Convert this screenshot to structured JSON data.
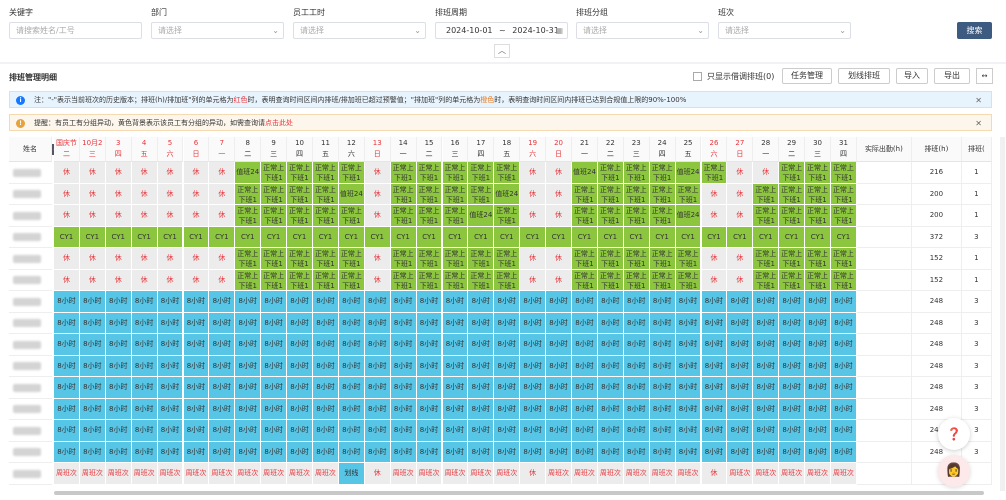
{
  "filters": {
    "keyword_label": "关键字",
    "keyword_placeholder": "请搜索姓名/工号",
    "dept_label": "部门",
    "dept_placeholder": "请选择",
    "worktime_label": "员工工时",
    "worktime_placeholder": "请选择",
    "period_label": "排班周期",
    "date_start": "2024-10-01",
    "date_sep": "~",
    "date_end": "2024-10-31",
    "group_label": "排班分组",
    "group_placeholder": "请选择",
    "shift_label": "班次",
    "shift_placeholder": "请选择",
    "search_button": "搜索"
  },
  "toolbar": {
    "title": "排班管理明细",
    "only_show_label": "只显示借调排班(0)",
    "task_mgmt": "任务管理",
    "batch_schedule": "划线排班",
    "import": "导入",
    "export": "导出"
  },
  "notices": {
    "info_prefix": "注：\"-\"表示当前班次的历史版本；排班(h)/排加班\"列的单元格为",
    "info_red": "红色",
    "info_mid": "时，表明查询时间区间内排班/排加班已超过预警值；\"排加班\"列的单元格为",
    "info_orange": "橙色",
    "info_suffix": "时，表明查询时间区间内排班已达到合规值上限的90%-100%",
    "warn_prefix": "提醒：有员工有分组异动，黄色背景表示该员工有分组的异动，如需查询请",
    "warn_link": "点击此处"
  },
  "table": {
    "name_header": "姓名",
    "actual_header": "实际出勤(h)",
    "sched_header": "排班(h)",
    "sched2_header": "排班(",
    "days": [
      {
        "d": "国庆节",
        "w": "二",
        "we": true
      },
      {
        "d": "10月2",
        "w": "三",
        "we": true
      },
      {
        "d": "3",
        "w": "四",
        "we": true
      },
      {
        "d": "4",
        "w": "五",
        "we": true
      },
      {
        "d": "5",
        "w": "六",
        "we": true
      },
      {
        "d": "6",
        "w": "日",
        "we": true
      },
      {
        "d": "7",
        "w": "一",
        "we": true
      },
      {
        "d": "8",
        "w": "二",
        "we": false
      },
      {
        "d": "9",
        "w": "三",
        "we": false
      },
      {
        "d": "10",
        "w": "四",
        "we": false
      },
      {
        "d": "11",
        "w": "五",
        "we": false
      },
      {
        "d": "12",
        "w": "六",
        "we": false
      },
      {
        "d": "13",
        "w": "日",
        "we": true
      },
      {
        "d": "14",
        "w": "一",
        "we": false
      },
      {
        "d": "15",
        "w": "二",
        "we": false
      },
      {
        "d": "16",
        "w": "三",
        "we": false
      },
      {
        "d": "17",
        "w": "四",
        "we": false
      },
      {
        "d": "18",
        "w": "五",
        "we": false
      },
      {
        "d": "19",
        "w": "六",
        "we": true
      },
      {
        "d": "20",
        "w": "日",
        "we": true
      },
      {
        "d": "21",
        "w": "一",
        "we": false
      },
      {
        "d": "22",
        "w": "二",
        "we": false
      },
      {
        "d": "23",
        "w": "三",
        "we": false
      },
      {
        "d": "24",
        "w": "四",
        "we": false
      },
      {
        "d": "25",
        "w": "五",
        "we": false
      },
      {
        "d": "26",
        "w": "六",
        "we": true
      },
      {
        "d": "27",
        "w": "日",
        "we": true
      },
      {
        "d": "28",
        "w": "一",
        "we": false
      },
      {
        "d": "29",
        "w": "二",
        "we": false
      },
      {
        "d": "30",
        "w": "三",
        "we": false
      },
      {
        "d": "31",
        "w": "四",
        "we": false
      }
    ],
    "shift_rest": "休",
    "shift_duty": "值班24",
    "shift_normal": "正常上下班1",
    "shift_cy1": "CY1",
    "shift_8h": "8小时",
    "shift_week": "周班次",
    "shift_line": "划线",
    "rows": [
      {
        "codes": "RRRRRRRDNNNNRNNNNNRRDNNNDNRRNNNN",
        "actual": "",
        "sched": "216",
        "sched2": "1"
      },
      {
        "codes": "RRRRRRRNNNNDRNNNNDRRNNNNNRRNNNNN",
        "actual": "",
        "sched": "200",
        "sched2": "1"
      },
      {
        "codes": "RRRRRRRNNNNNRNNNDNRRNNNNDRRNNNNN",
        "actual": "",
        "sched": "200",
        "sched2": "1"
      },
      {
        "codes": "CCCCCCCCCCCCCCCCCCCCCCCCCCCCCCCC",
        "actual": "",
        "sched": "372",
        "sched2": "3"
      },
      {
        "codes": "RRRRRRRNNNNNRNNNNNRRNNNNNRRNNNNN",
        "actual": "",
        "sched": "152",
        "sched2": "1"
      },
      {
        "codes": "RRRRRRRNNNNNRNNNNNRRNNNNNRRNNNNN",
        "actual": "",
        "sched": "152",
        "sched2": "1"
      },
      {
        "codes": "HHHHHHHHHHHHHHHHHHHHHHHHHHHHHHHH",
        "actual": "",
        "sched": "248",
        "sched2": "3"
      },
      {
        "codes": "HHHHHHHHHHHHHHHHHHHHHHHHHHHHHHHH",
        "actual": "",
        "sched": "248",
        "sched2": "3"
      },
      {
        "codes": "HHHHHHHHHHHHHHHHHHHHHHHHHHHHHHHH",
        "actual": "",
        "sched": "248",
        "sched2": "3"
      },
      {
        "codes": "HHHHHHHHHHHHHHHHHHHHHHHHHHHHHHHH",
        "actual": "",
        "sched": "248",
        "sched2": "3"
      },
      {
        "codes": "HHHHHHHHHHHHHHHHHHHHHHHHHHHHHHHH",
        "actual": "",
        "sched": "248",
        "sched2": "3"
      },
      {
        "codes": "HHHHHHHHHHHHHHHHHHHHHHHHHHHHHHHH",
        "actual": "",
        "sched": "248",
        "sched2": "3"
      },
      {
        "codes": "HHHHHHHHHHHHHHHHHHHHHHHHHHHHHHHH",
        "actual": "",
        "sched": "248",
        "sched2": "3"
      },
      {
        "codes": "HHHHHHHHHHHHHHHHHHHHHHHHHHHHHHHH",
        "actual": "",
        "sched": "248",
        "sched2": "3"
      },
      {
        "codes": "WWWWWWWWWWWLRWWWWWRWWWWWWRWWWWWW",
        "actual": "",
        "sched": "",
        "sched2": ""
      }
    ]
  },
  "colors": {
    "rest": "#ececec",
    "green": "#8cc63f",
    "blue": "#56c5e6",
    "accent": "#3d5a80"
  }
}
